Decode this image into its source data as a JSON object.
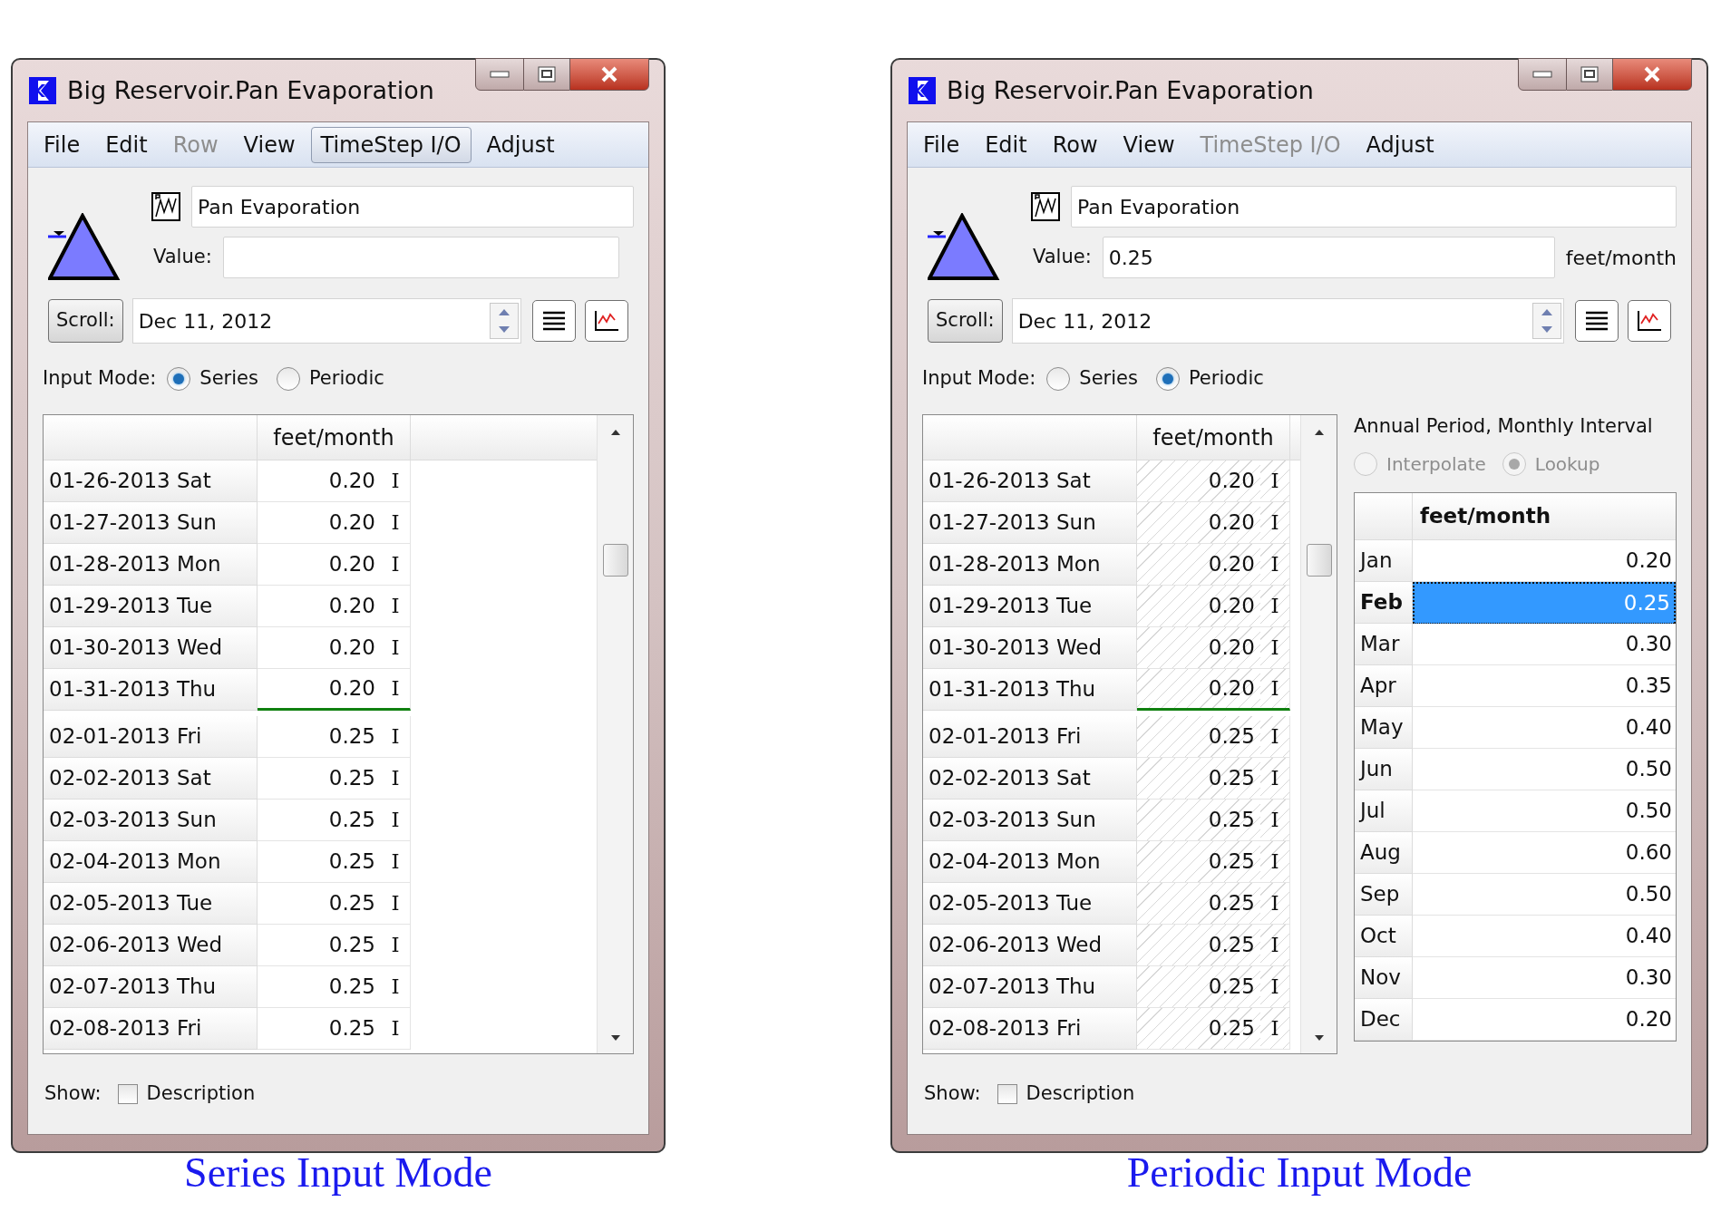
{
  "panels": [
    {
      "caption": "Series Input Mode",
      "window": {
        "title": "Big Reservoir.Pan Evaporation",
        "menu": [
          {
            "label": "File",
            "disabled": false,
            "selected": false
          },
          {
            "label": "Edit",
            "disabled": false,
            "selected": false
          },
          {
            "label": "Row",
            "disabled": true,
            "selected": false
          },
          {
            "label": "View",
            "disabled": false,
            "selected": false
          },
          {
            "label": "TimeStep I/O",
            "disabled": false,
            "selected": true
          },
          {
            "label": "Adjust",
            "disabled": false,
            "selected": false
          }
        ],
        "object_name": "Pan Evaporation",
        "value_label": "Value:",
        "scroll_button": "Scroll:",
        "date": "Dec 11, 2012",
        "input_mode_label": "Input Mode:",
        "modes": [
          {
            "label": "Series",
            "selected": true
          },
          {
            "label": "Periodic",
            "selected": false
          }
        ],
        "table": {
          "column": "feet/month",
          "read_only": false,
          "rows": [
            {
              "date": "01-26-2013 Sat",
              "value": "0.20",
              "flag": "I",
              "month_boundary": false
            },
            {
              "date": "01-27-2013 Sun",
              "value": "0.20",
              "flag": "I",
              "month_boundary": false
            },
            {
              "date": "01-28-2013 Mon",
              "value": "0.20",
              "flag": "I",
              "month_boundary": false
            },
            {
              "date": "01-29-2013 Tue",
              "value": "0.20",
              "flag": "I",
              "month_boundary": false
            },
            {
              "date": "01-30-2013 Wed",
              "value": "0.20",
              "flag": "I",
              "month_boundary": false
            },
            {
              "date": "01-31-2013 Thu",
              "value": "0.20",
              "flag": "I",
              "month_boundary": true
            },
            {
              "date": "02-01-2013 Fri",
              "value": "0.25",
              "flag": "I",
              "month_boundary": false
            },
            {
              "date": "02-02-2013 Sat",
              "value": "0.25",
              "flag": "I",
              "month_boundary": false
            },
            {
              "date": "02-03-2013 Sun",
              "value": "0.25",
              "flag": "I",
              "month_boundary": false
            },
            {
              "date": "02-04-2013 Mon",
              "value": "0.25",
              "flag": "I",
              "month_boundary": false
            },
            {
              "date": "02-05-2013 Tue",
              "value": "0.25",
              "flag": "I",
              "month_boundary": false
            },
            {
              "date": "02-06-2013 Wed",
              "value": "0.25",
              "flag": "I",
              "month_boundary": false
            },
            {
              "date": "02-07-2013 Thu",
              "value": "0.25",
              "flag": "I",
              "month_boundary": false
            },
            {
              "date": "02-08-2013 Fri",
              "value": "0.25",
              "flag": "I",
              "month_boundary": false
            }
          ]
        },
        "show_label": "Show:",
        "show_options": [
          {
            "label": "Description",
            "checked": false
          }
        ]
      }
    },
    {
      "caption": "Periodic Input Mode",
      "window": {
        "title": "Big Reservoir.Pan Evaporation",
        "menu": [
          {
            "label": "File",
            "disabled": false,
            "selected": false
          },
          {
            "label": "Edit",
            "disabled": false,
            "selected": false
          },
          {
            "label": "Row",
            "disabled": false,
            "selected": false
          },
          {
            "label": "View",
            "disabled": false,
            "selected": false
          },
          {
            "label": "TimeStep I/O",
            "disabled": true,
            "selected": false
          },
          {
            "label": "Adjust",
            "disabled": false,
            "selected": false
          }
        ],
        "object_name": "Pan Evaporation",
        "value_label": "Value:",
        "value": "0.25",
        "value_unit": "feet/month",
        "scroll_button": "Scroll:",
        "date": "Dec 11, 2012",
        "input_mode_label": "Input Mode:",
        "modes": [
          {
            "label": "Series",
            "selected": false
          },
          {
            "label": "Periodic",
            "selected": true
          }
        ],
        "table": {
          "column": "feet/month",
          "read_only": true,
          "rows": [
            {
              "date": "01-26-2013 Sat",
              "value": "0.20",
              "flag": "I",
              "month_boundary": false
            },
            {
              "date": "01-27-2013 Sun",
              "value": "0.20",
              "flag": "I",
              "month_boundary": false
            },
            {
              "date": "01-28-2013 Mon",
              "value": "0.20",
              "flag": "I",
              "month_boundary": false
            },
            {
              "date": "01-29-2013 Tue",
              "value": "0.20",
              "flag": "I",
              "month_boundary": false
            },
            {
              "date": "01-30-2013 Wed",
              "value": "0.20",
              "flag": "I",
              "month_boundary": false
            },
            {
              "date": "01-31-2013 Thu",
              "value": "0.20",
              "flag": "I",
              "month_boundary": true
            },
            {
              "date": "02-01-2013 Fri",
              "value": "0.25",
              "flag": "I",
              "month_boundary": false
            },
            {
              "date": "02-02-2013 Sat",
              "value": "0.25",
              "flag": "I",
              "month_boundary": false
            },
            {
              "date": "02-03-2013 Sun",
              "value": "0.25",
              "flag": "I",
              "month_boundary": false
            },
            {
              "date": "02-04-2013 Mon",
              "value": "0.25",
              "flag": "I",
              "month_boundary": false
            },
            {
              "date": "02-05-2013 Tue",
              "value": "0.25",
              "flag": "I",
              "month_boundary": false
            },
            {
              "date": "02-06-2013 Wed",
              "value": "0.25",
              "flag": "I",
              "month_boundary": false
            },
            {
              "date": "02-07-2013 Thu",
              "value": "0.25",
              "flag": "I",
              "month_boundary": false
            },
            {
              "date": "02-08-2013 Fri",
              "value": "0.25",
              "flag": "I",
              "month_boundary": false
            }
          ]
        },
        "periodic": {
          "title": "Annual Period, Monthly Interval",
          "disabled": true,
          "methods": [
            {
              "label": "Interpolate",
              "selected": false
            },
            {
              "label": "Lookup",
              "selected": true
            }
          ],
          "column": "feet/month",
          "rows": [
            {
              "period": "Jan",
              "value": "0.20",
              "selected": false
            },
            {
              "period": "Feb",
              "value": "0.25",
              "selected": true
            },
            {
              "period": "Mar",
              "value": "0.30",
              "selected": false
            },
            {
              "period": "Apr",
              "value": "0.35",
              "selected": false
            },
            {
              "period": "May",
              "value": "0.40",
              "selected": false
            },
            {
              "period": "Jun",
              "value": "0.50",
              "selected": false
            },
            {
              "period": "Jul",
              "value": "0.50",
              "selected": false
            },
            {
              "period": "Aug",
              "value": "0.60",
              "selected": false
            },
            {
              "period": "Sep",
              "value": "0.50",
              "selected": false
            },
            {
              "period": "Oct",
              "value": "0.40",
              "selected": false
            },
            {
              "period": "Nov",
              "value": "0.30",
              "selected": false
            },
            {
              "period": "Dec",
              "value": "0.20",
              "selected": false
            }
          ]
        },
        "show_label": "Show:",
        "show_options": [
          {
            "label": "Description",
            "checked": false
          }
        ]
      }
    }
  ]
}
